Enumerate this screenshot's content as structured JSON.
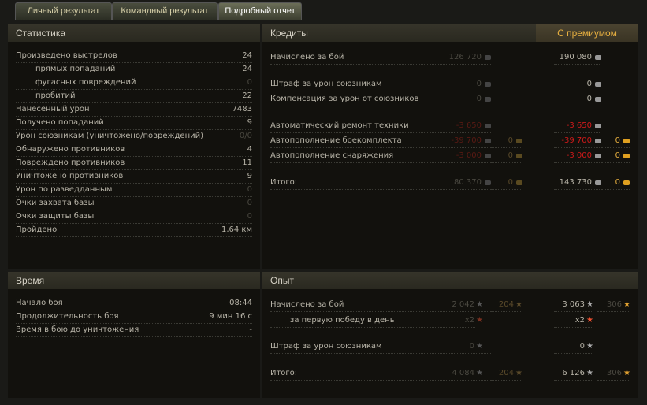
{
  "tabs": [
    "Личный результат",
    "Командный результат",
    "Подробный отчет"
  ],
  "stats": {
    "title": "Статистика",
    "rows": [
      {
        "label": "Произведено выстрелов",
        "value": "24"
      },
      {
        "label": "прямых попаданий",
        "value": "24",
        "indent": true
      },
      {
        "label": "фугасных повреждений",
        "value": "0",
        "indent": true,
        "dim": true
      },
      {
        "label": "пробитий",
        "value": "22",
        "indent": true
      },
      {
        "label": "Нанесенный урон",
        "value": "7483"
      },
      {
        "label": "Получено попаданий",
        "value": "9"
      },
      {
        "label": "Урон союзникам (уничтожено/повреждений)",
        "value": "0/0",
        "dim": true
      },
      {
        "label": "Обнаружено противников",
        "value": "4"
      },
      {
        "label": "Повреждено противников",
        "value": "11"
      },
      {
        "label": "Уничтожено противников",
        "value": "9"
      },
      {
        "label": "Урон по разведданным",
        "value": "0",
        "dim": true
      },
      {
        "label": "Очки захвата базы",
        "value": "0",
        "dim": true
      },
      {
        "label": "Очки защиты базы",
        "value": "0",
        "dim": true
      },
      {
        "label": "Пройдено",
        "value": "1,64 км"
      }
    ]
  },
  "time": {
    "title": "Время",
    "rows": [
      {
        "label": "Начало боя",
        "value": "08:44"
      },
      {
        "label": "Продолжительность боя",
        "value": "9 мин 16 с"
      },
      {
        "label": "Время в бою до уничтожения",
        "value": "-"
      }
    ]
  },
  "credits": {
    "title": "Кредиты",
    "premium_title": "С премиумом",
    "rows": [
      {
        "label": "Начислено за бой",
        "base": "126 720",
        "prem": "190 080"
      },
      {
        "label": "Штраф за урон союзникам",
        "base": "0",
        "prem": "0"
      },
      {
        "label": "Компенсация за урон от союзников",
        "base": "0",
        "prem": "0"
      },
      {
        "label": "Автоматический ремонт техники",
        "base": "-3 650",
        "prem": "-3 650",
        "neg": true
      },
      {
        "label": "Автопополнение боекомплекта",
        "base": "-39 700",
        "prem": "-39 700",
        "gold": "0",
        "pgold": "0",
        "neg": true
      },
      {
        "label": "Автопополнение снаряжения",
        "base": "-3 000",
        "prem": "-3 000",
        "gold": "0",
        "pgold": "0",
        "neg": true
      },
      {
        "label": "Итого:",
        "base": "80 370",
        "prem": "143 730",
        "gold": "0",
        "pgold": "0"
      }
    ]
  },
  "exp": {
    "title": "Опыт",
    "rows": [
      {
        "label": "Начислено за бой",
        "base": "2 042",
        "prem": "3 063",
        "free": "204",
        "pfree": "306"
      },
      {
        "label": "за первую победу в день",
        "base": "x2",
        "prem": "x2",
        "indent": true
      },
      {
        "label": "Штраф за урон союзникам",
        "base": "0",
        "prem": "0"
      },
      {
        "label": "Итого:",
        "base": "4 084",
        "prem": "6 126",
        "free": "204",
        "pfree": "306"
      }
    ]
  }
}
